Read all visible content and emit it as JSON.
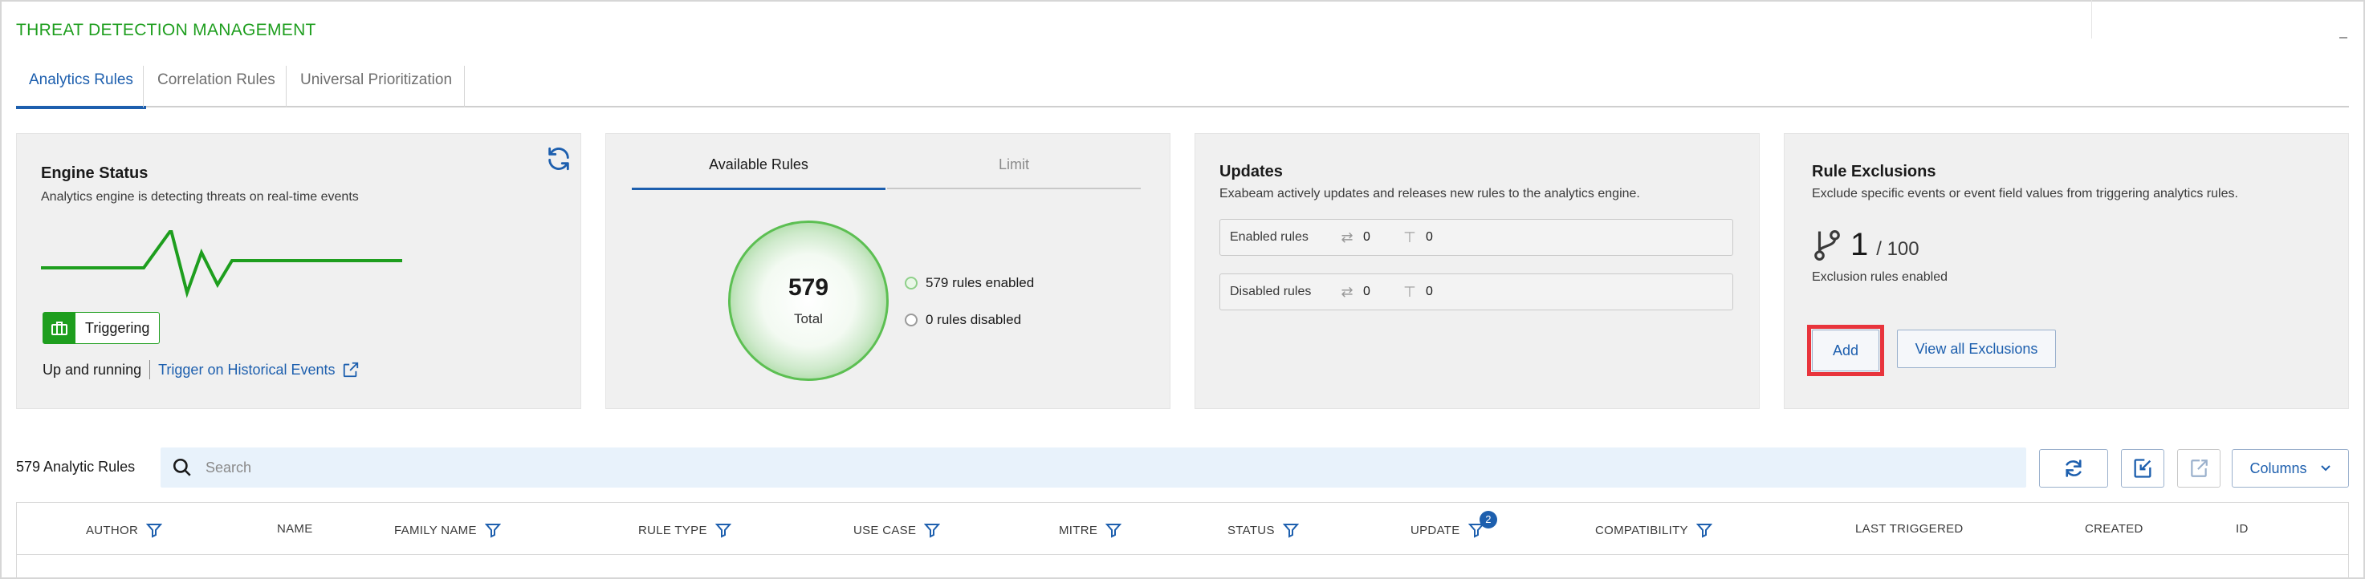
{
  "app": {
    "title": "THREAT DETECTION MANAGEMENT"
  },
  "tabs": [
    {
      "label": "Analytics Rules",
      "active": true
    },
    {
      "label": "Correlation Rules",
      "active": false
    },
    {
      "label": "Universal Prioritization",
      "active": false
    }
  ],
  "engine_status": {
    "title": "Engine Status",
    "subtitle": "Analytics engine is detecting threats on real-time events",
    "badge_label": "Triggering",
    "status_text": "Up and running",
    "historical_link": "Trigger on Historical Events"
  },
  "available_rules": {
    "tab_available": "Available Rules",
    "tab_limit": "Limit",
    "total_value": "579",
    "total_label": "Total",
    "enabled_text": "579 rules enabled",
    "disabled_text": "0 rules disabled"
  },
  "updates": {
    "title": "Updates",
    "subtitle": "Exabeam actively updates and releases new rules to the analytics engine.",
    "enabled": {
      "label": "Enabled rules",
      "updated": "0",
      "new": "0"
    },
    "disabled": {
      "label": "Disabled rules",
      "updated": "0",
      "new": "0"
    }
  },
  "rule_exclusions": {
    "title": "Rule Exclusions",
    "subtitle": "Exclude specific events or event field values from triggering analytics rules.",
    "count": "1",
    "limit": "/ 100",
    "caption": "Exclusion rules enabled",
    "add_label": "Add",
    "view_all_label": "View all Exclusions"
  },
  "toolbar": {
    "rules_count": "579 Analytic Rules",
    "search_placeholder": "Search",
    "columns_label": "Columns"
  },
  "table": {
    "columns": [
      {
        "label": "AUTHOR",
        "filter": true
      },
      {
        "label": "NAME",
        "filter": false
      },
      {
        "label": "FAMILY NAME",
        "filter": true
      },
      {
        "label": "RULE TYPE",
        "filter": true
      },
      {
        "label": "USE CASE",
        "filter": true
      },
      {
        "label": "MITRE",
        "filter": true
      },
      {
        "label": "STATUS",
        "filter": true
      },
      {
        "label": "UPDATE",
        "filter": true,
        "badge": "2"
      },
      {
        "label": "COMPATIBILITY",
        "filter": true
      },
      {
        "label": "LAST TRIGGERED",
        "filter": false
      },
      {
        "label": "CREATED",
        "filter": false
      },
      {
        "label": "ID",
        "filter": false
      }
    ]
  },
  "colors": {
    "accent": "#1d5fae",
    "brand_green": "#1e9e1e",
    "highlight_red": "#e8343c",
    "card_bg": "#f0f0f0"
  }
}
